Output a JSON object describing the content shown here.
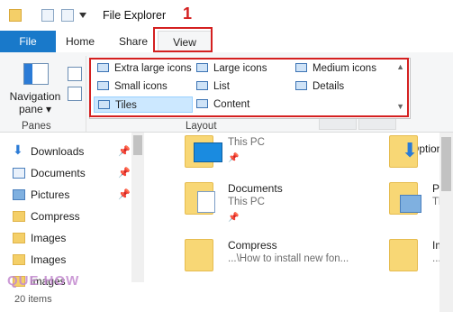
{
  "window": {
    "title": "File Explorer",
    "step_number": "1"
  },
  "tabs": {
    "file": "File",
    "home": "Home",
    "share": "Share",
    "view": "View"
  },
  "ribbon": {
    "navigation_pane_label": "Navigation pane ▾",
    "panes_group_label": "Panes",
    "layout_group_label": "Layout",
    "options_label": "Options",
    "layout_items": [
      {
        "label": "Extra large icons"
      },
      {
        "label": "Large icons"
      },
      {
        "label": "Medium icons"
      },
      {
        "label": "Small icons"
      },
      {
        "label": "List"
      },
      {
        "label": "Details"
      },
      {
        "label": "Tiles"
      },
      {
        "label": "Content"
      }
    ],
    "selected_layout": "Tiles"
  },
  "nav_pane": {
    "items": [
      {
        "label": "Downloads",
        "icon": "download-arrow-icon",
        "pinned": true
      },
      {
        "label": "Documents",
        "icon": "documents-icon",
        "pinned": true
      },
      {
        "label": "Pictures",
        "icon": "pictures-icon",
        "pinned": true
      },
      {
        "label": "Compress",
        "icon": "folder-icon",
        "pinned": false
      },
      {
        "label": "Images",
        "icon": "folder-icon",
        "pinned": false
      },
      {
        "label": "Images",
        "icon": "folder-icon",
        "pinned": false
      },
      {
        "label": "images",
        "icon": "folder-icon",
        "pinned": false
      }
    ]
  },
  "content": {
    "tiles": [
      {
        "name": "",
        "location": "This PC"
      },
      {
        "name": "Documents",
        "location": "This PC"
      },
      {
        "name": "Compress",
        "location": "...\\How to install new fon..."
      },
      {
        "name": "Pict",
        "location": "This"
      },
      {
        "name": "Ima",
        "location": "...\\H"
      }
    ]
  },
  "status": {
    "items_count": "20 items"
  },
  "watermark": {
    "text": "QUE HOW"
  },
  "colors": {
    "accent": "#1979ca",
    "highlight_red": "#d42020",
    "selection": "#cce8ff"
  }
}
